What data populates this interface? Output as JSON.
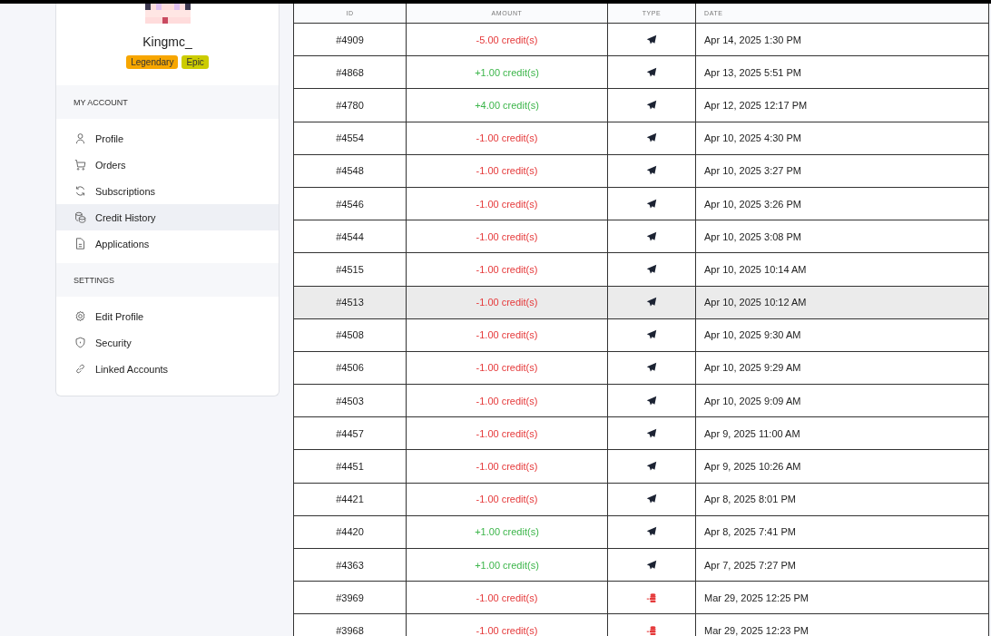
{
  "profile": {
    "username": "Kingmc_",
    "badges": [
      {
        "label": "Legendary",
        "color": "#f7a600"
      },
      {
        "label": "Epic",
        "color": "#cccc00"
      }
    ]
  },
  "sidebar": {
    "sections": [
      {
        "title": "MY ACCOUNT",
        "items": [
          {
            "label": "Profile",
            "selected": false
          },
          {
            "label": "Orders",
            "selected": false
          },
          {
            "label": "Subscriptions",
            "selected": false
          },
          {
            "label": "Credit History",
            "selected": true
          },
          {
            "label": "Applications",
            "selected": false
          }
        ]
      },
      {
        "title": "SETTINGS",
        "items": [
          {
            "label": "Edit Profile",
            "selected": false
          },
          {
            "label": "Security",
            "selected": false
          },
          {
            "label": "Linked Accounts",
            "selected": false
          }
        ]
      }
    ]
  },
  "table": {
    "columns": [
      "ID",
      "AMOUNT",
      "TYPE",
      "DATE"
    ],
    "rows": [
      {
        "id": "#4909",
        "amount": "-5.00 credit(s)",
        "color": "#e5393a",
        "kind": "send",
        "date": "Apr 14, 2025 1:30 PM",
        "highlighted": false
      },
      {
        "id": "#4868",
        "amount": "+1.00 credit(s)",
        "color": "#3cb54a",
        "kind": "send",
        "date": "Apr 13, 2025 5:51 PM",
        "highlighted": false
      },
      {
        "id": "#4780",
        "amount": "+4.00 credit(s)",
        "color": "#3cb54a",
        "kind": "send",
        "date": "Apr 12, 2025 12:17 PM",
        "highlighted": false
      },
      {
        "id": "#4554",
        "amount": "-1.00 credit(s)",
        "color": "#e5393a",
        "kind": "send",
        "date": "Apr 10, 2025 4:30 PM",
        "highlighted": false
      },
      {
        "id": "#4548",
        "amount": "-1.00 credit(s)",
        "color": "#e5393a",
        "kind": "send",
        "date": "Apr 10, 2025 3:27 PM",
        "highlighted": false
      },
      {
        "id": "#4546",
        "amount": "-1.00 credit(s)",
        "color": "#e5393a",
        "kind": "send",
        "date": "Apr 10, 2025 3:26 PM",
        "highlighted": false
      },
      {
        "id": "#4544",
        "amount": "-1.00 credit(s)",
        "color": "#e5393a",
        "kind": "send",
        "date": "Apr 10, 2025 3:08 PM",
        "highlighted": false
      },
      {
        "id": "#4515",
        "amount": "-1.00 credit(s)",
        "color": "#e5393a",
        "kind": "send",
        "date": "Apr 10, 2025 10:14 AM",
        "highlighted": false
      },
      {
        "id": "#4513",
        "amount": "-1.00 credit(s)",
        "color": "#e5393a",
        "kind": "send",
        "date": "Apr 10, 2025 10:12 AM",
        "highlighted": true
      },
      {
        "id": "#4508",
        "amount": "-1.00 credit(s)",
        "color": "#e5393a",
        "kind": "send",
        "date": "Apr 10, 2025 9:30 AM",
        "highlighted": false
      },
      {
        "id": "#4506",
        "amount": "-1.00 credit(s)",
        "color": "#e5393a",
        "kind": "send",
        "date": "Apr 10, 2025 9:29 AM",
        "highlighted": false
      },
      {
        "id": "#4503",
        "amount": "-1.00 credit(s)",
        "color": "#e5393a",
        "kind": "send",
        "date": "Apr 10, 2025 9:09 AM",
        "highlighted": false
      },
      {
        "id": "#4457",
        "amount": "-1.00 credit(s)",
        "color": "#e5393a",
        "kind": "send",
        "date": "Apr 9, 2025 11:00 AM",
        "highlighted": false
      },
      {
        "id": "#4451",
        "amount": "-1.00 credit(s)",
        "color": "#e5393a",
        "kind": "send",
        "date": "Apr 9, 2025 10:26 AM",
        "highlighted": false
      },
      {
        "id": "#4421",
        "amount": "-1.00 credit(s)",
        "color": "#e5393a",
        "kind": "send",
        "date": "Apr 8, 2025 8:01 PM",
        "highlighted": false
      },
      {
        "id": "#4420",
        "amount": "+1.00 credit(s)",
        "color": "#3cb54a",
        "kind": "send",
        "date": "Apr 8, 2025 7:41 PM",
        "highlighted": false
      },
      {
        "id": "#4363",
        "amount": "+1.00 credit(s)",
        "color": "#3cb54a",
        "kind": "send",
        "date": "Apr 7, 2025 7:27 PM",
        "highlighted": false
      },
      {
        "id": "#3969",
        "amount": "-1.00 credit(s)",
        "color": "#e5393a",
        "kind": "coins",
        "date": "Mar 29, 2025 12:25 PM",
        "highlighted": false
      },
      {
        "id": "#3968",
        "amount": "-1.00 credit(s)",
        "color": "#e5393a",
        "kind": "coins",
        "date": "Mar 29, 2025 12:23 PM",
        "highlighted": false
      }
    ]
  }
}
